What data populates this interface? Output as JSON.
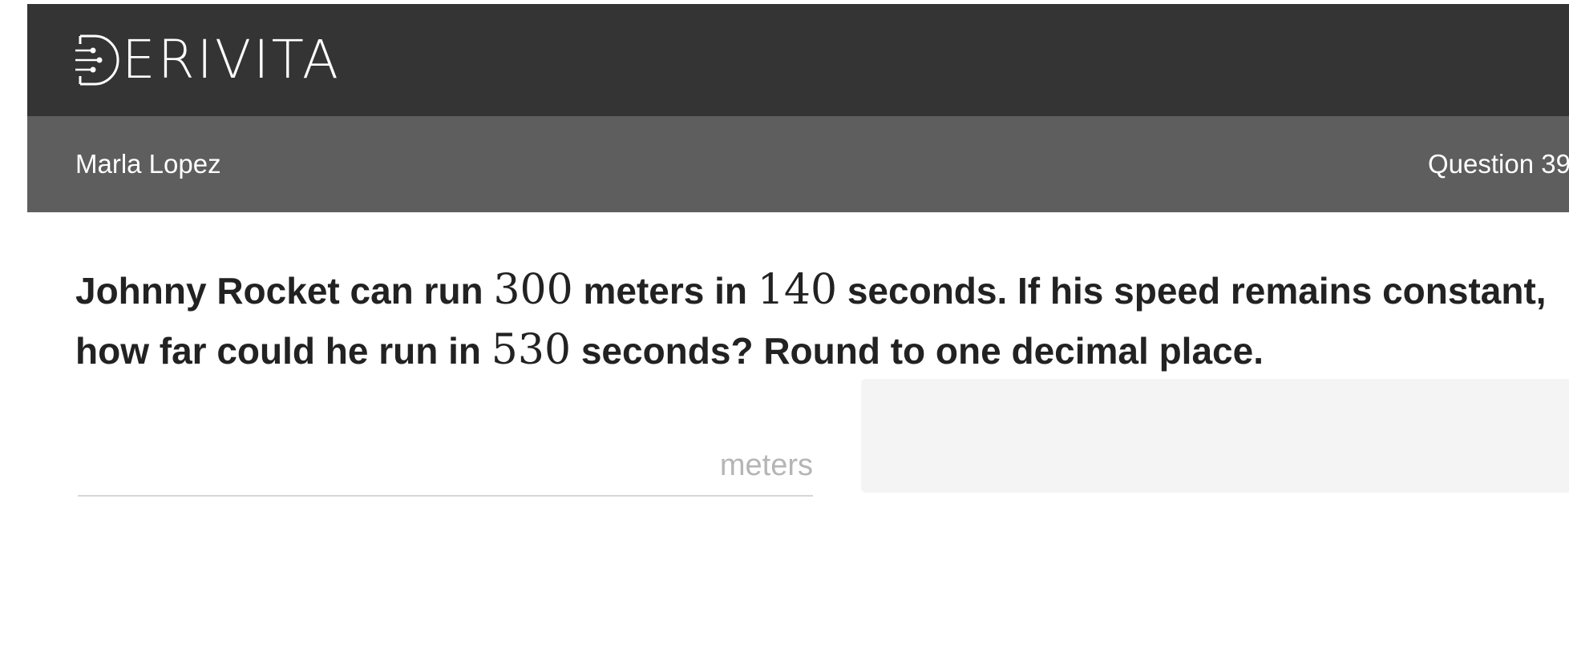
{
  "header": {
    "logo_text": "ERIVITA",
    "logo_icon": "derivita-d-circuit-icon",
    "background": "#343434"
  },
  "subheader": {
    "student_name": "Marla Lopez",
    "question_label": "Question 39",
    "background": "#5e5e5e"
  },
  "question": {
    "part1": "Johnny Rocket can run ",
    "num1": "300",
    "part2": " meters in ",
    "num2": "140",
    "part3": " seconds. If his speed remains constant,",
    "part4": "how far could he run in ",
    "num3": "530",
    "part5": " seconds? Round to one decimal place."
  },
  "answer": {
    "value": "",
    "unit": "meters"
  },
  "colors": {
    "text": "#222222",
    "unit": "#b5b5b5",
    "panel": "#f4f4f4"
  }
}
